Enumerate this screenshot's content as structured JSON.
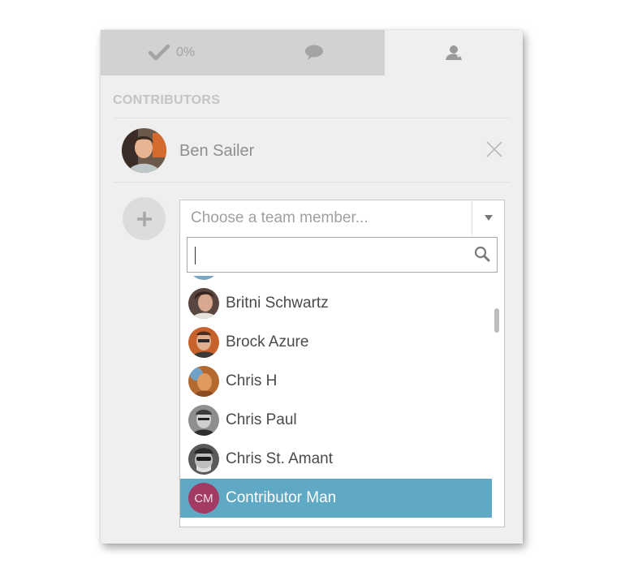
{
  "tabs": [
    {
      "name": "checklist",
      "label": "0%",
      "icon": "checkmark-icon"
    },
    {
      "name": "comments",
      "label": "",
      "icon": "speech-bubble-icon"
    },
    {
      "name": "contributors",
      "label": "",
      "icon": "user-icon",
      "active": true
    }
  ],
  "section_title": "CONTRIBUTORS",
  "contributor": {
    "name": "Ben Sailer"
  },
  "select": {
    "placeholder": "Choose a team member..."
  },
  "search": {
    "value": ""
  },
  "members": [
    {
      "name": "",
      "partial": true
    },
    {
      "name": "Britni Schwartz"
    },
    {
      "name": "Brock Azure"
    },
    {
      "name": "Chris H"
    },
    {
      "name": "Chris Paul"
    },
    {
      "name": "Chris St. Amant"
    },
    {
      "name": "Contributor Man",
      "initials": "CM",
      "selected": true
    }
  ],
  "colors": {
    "selected": "#5fa9c4",
    "initials_bg": "#a33a63",
    "panel_bg": "#efefef",
    "tab_bg": "#d2d2d2"
  }
}
